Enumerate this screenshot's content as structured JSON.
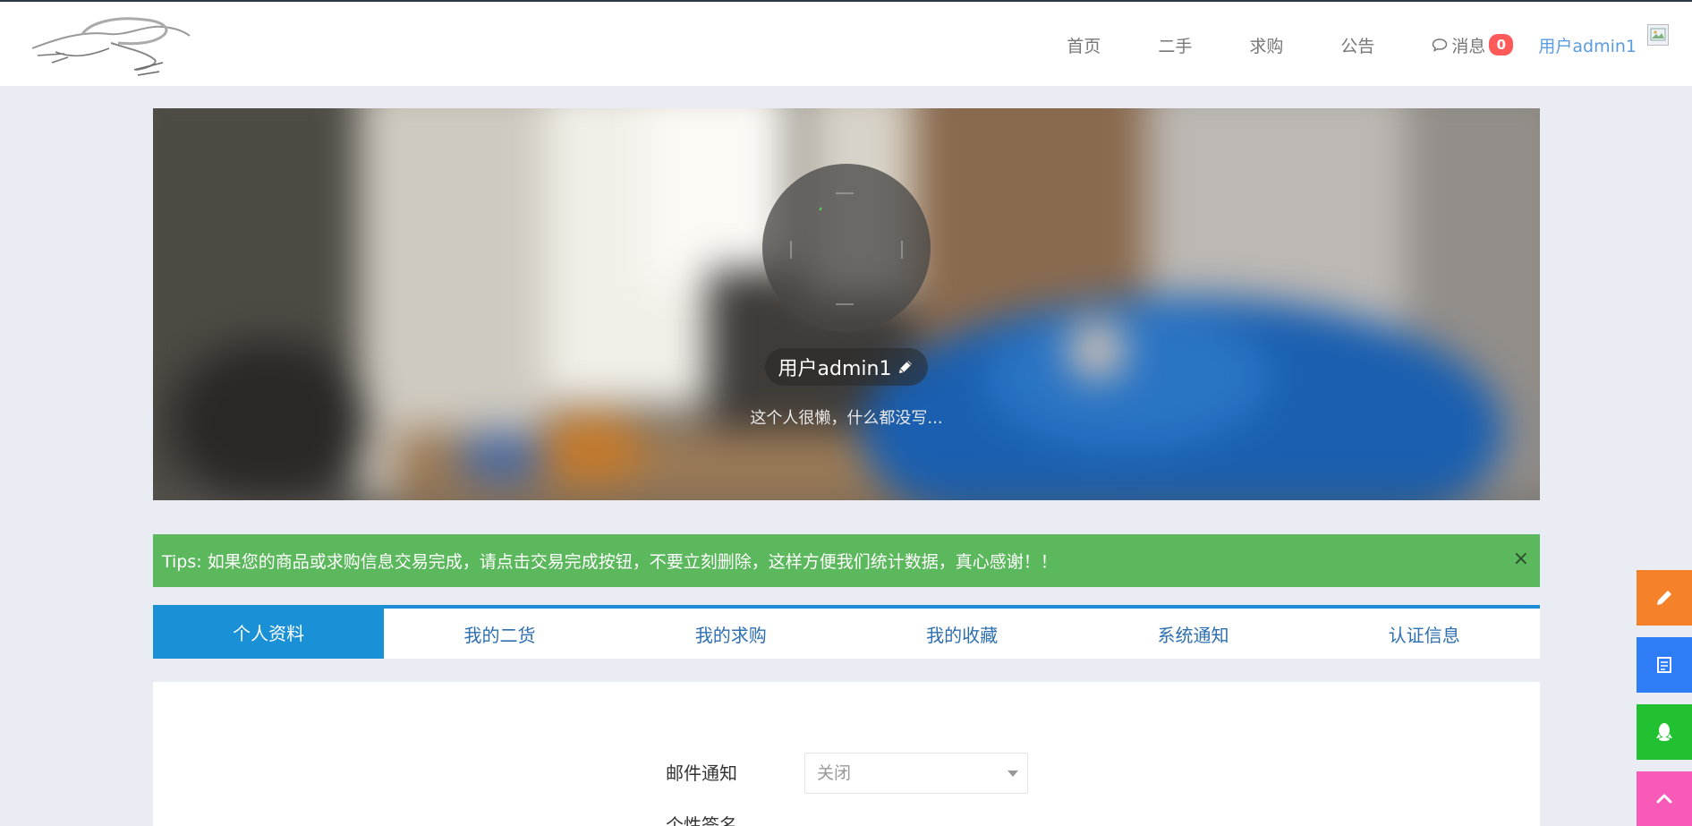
{
  "header": {
    "nav": [
      "首页",
      "二手",
      "求购",
      "公告"
    ],
    "messages_label": "消息",
    "messages_count": "0",
    "user_label": "用户admin1"
  },
  "profile": {
    "name": "用户admin1",
    "signature": "这个人很懒，什么都没写..."
  },
  "tips": {
    "text": "Tips: 如果您的商品或求购信息交易完成，请点击交易完成按钮，不要立刻删除，这样方便我们统计数据，真心感谢！！",
    "close": "×"
  },
  "tabs": [
    {
      "label": "个人资料",
      "active": true
    },
    {
      "label": "我的二货",
      "active": false
    },
    {
      "label": "我的求购",
      "active": false
    },
    {
      "label": "我的收藏",
      "active": false
    },
    {
      "label": "系统通知",
      "active": false
    },
    {
      "label": "认证信息",
      "active": false
    }
  ],
  "form": {
    "email_notify_label": "邮件通知",
    "email_notify_value": "关闭",
    "next_label": "个性签名"
  },
  "side_buttons": [
    {
      "icon": "pencil-icon",
      "color": "#f5812b"
    },
    {
      "icon": "note-icon",
      "color": "#2f7df6"
    },
    {
      "icon": "qq-icon",
      "color": "#22c131"
    },
    {
      "icon": "chevron-up-icon",
      "color": "#f75ab7"
    }
  ]
}
